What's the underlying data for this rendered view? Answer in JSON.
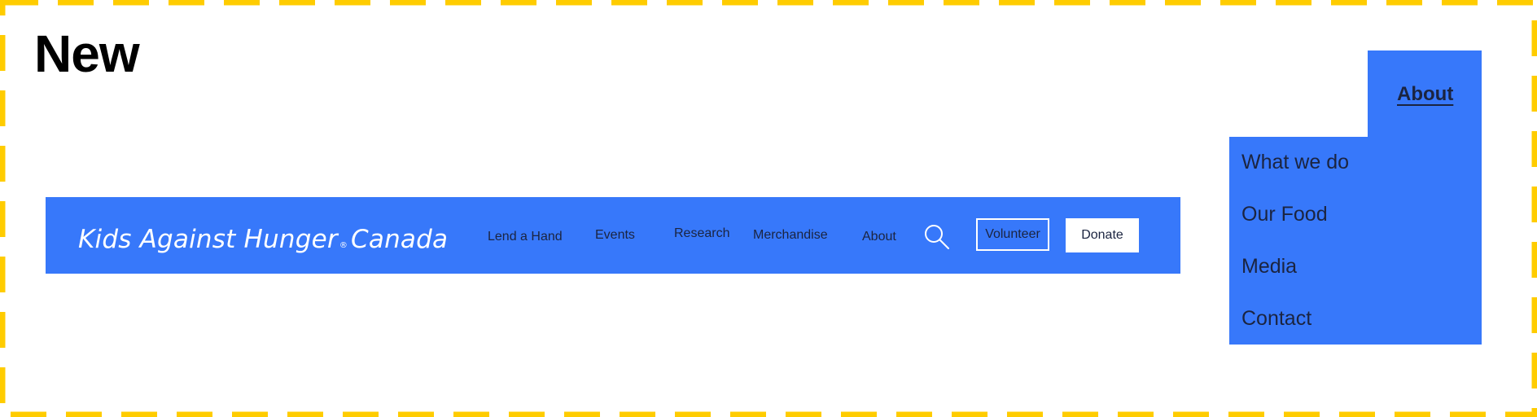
{
  "section_title": "New",
  "navbar": {
    "brand": {
      "name_part1": "Kids Against Hunger",
      "registered_mark": "®",
      "name_part2": "Canada"
    },
    "links": [
      {
        "label": "Lend a Hand"
      },
      {
        "label": "Events"
      },
      {
        "label": "Research"
      },
      {
        "label": "Merchandise"
      },
      {
        "label": "About"
      }
    ],
    "search_icon": "search-icon",
    "volunteer_label": "Volunteer",
    "donate_label": "Donate"
  },
  "about_menu": {
    "title": "About",
    "items": [
      {
        "label": "What we do"
      },
      {
        "label": "Our Food"
      },
      {
        "label": "Media"
      },
      {
        "label": "Contact"
      }
    ]
  },
  "colors": {
    "nav_blue": "#3778fa",
    "frame_dash": "#ffcc00",
    "text_dark": "#1b2440"
  }
}
